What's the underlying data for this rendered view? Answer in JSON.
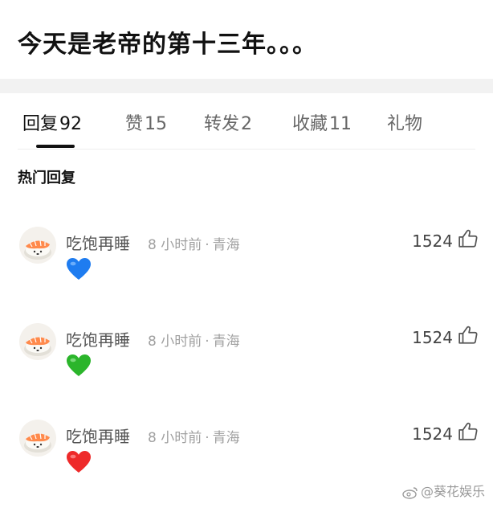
{
  "post": {
    "title": "今天是老帝的第十三年。。。"
  },
  "tabs": [
    {
      "label": "回复",
      "count": "92"
    },
    {
      "label": "赞",
      "count": "15"
    },
    {
      "label": "转发",
      "count": "2"
    },
    {
      "label": "收藏",
      "count": "11"
    },
    {
      "label": "礼物",
      "count": ""
    }
  ],
  "section": {
    "title": "热门回复"
  },
  "comments": [
    {
      "user": "吃饱再睡",
      "time": "8 小时前",
      "separator": "·",
      "location": "青海",
      "likes": "1524",
      "emoji": "blue-heart",
      "emoji_color": "#1e7cf0"
    },
    {
      "user": "吃饱再睡",
      "time": "8 小时前",
      "separator": "·",
      "location": "青海",
      "likes": "1524",
      "emoji": "green-heart",
      "emoji_color": "#2bb52b"
    },
    {
      "user": "吃饱再睡",
      "time": "8 小时前",
      "separator": "·",
      "location": "青海",
      "likes": "1524",
      "emoji": "red-heart",
      "emoji_color": "#ee2a2a"
    }
  ],
  "watermark": {
    "text": "@葵花娱乐",
    "icon": "weibo-icon"
  },
  "colors": {
    "text_primary": "#111111",
    "text_secondary": "#666666",
    "meta_gray": "#a0a0a0",
    "band_gray": "#f2f2f2"
  }
}
